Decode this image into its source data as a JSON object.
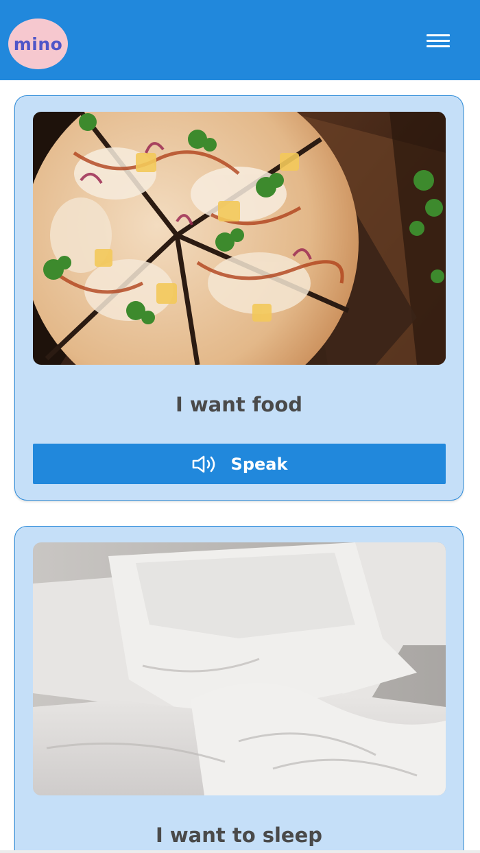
{
  "header": {
    "logo_text": "mino",
    "menu_icon": "hamburger-menu-icon",
    "background": "#2188dc",
    "logo_background": "#f6c8cf",
    "logo_color": "#4f56c8"
  },
  "cards": [
    {
      "image": "pizza-photo",
      "caption": "I want food",
      "button_label": "Speak",
      "button_icon": "speaker-icon"
    },
    {
      "image": "bed-pillows-photo",
      "caption": "I want to sleep"
    }
  ],
  "colors": {
    "card_background": "#c5dff8",
    "card_border": "#2b8ad9",
    "button": "#2188dc",
    "caption_text": "#4a4a4a"
  }
}
